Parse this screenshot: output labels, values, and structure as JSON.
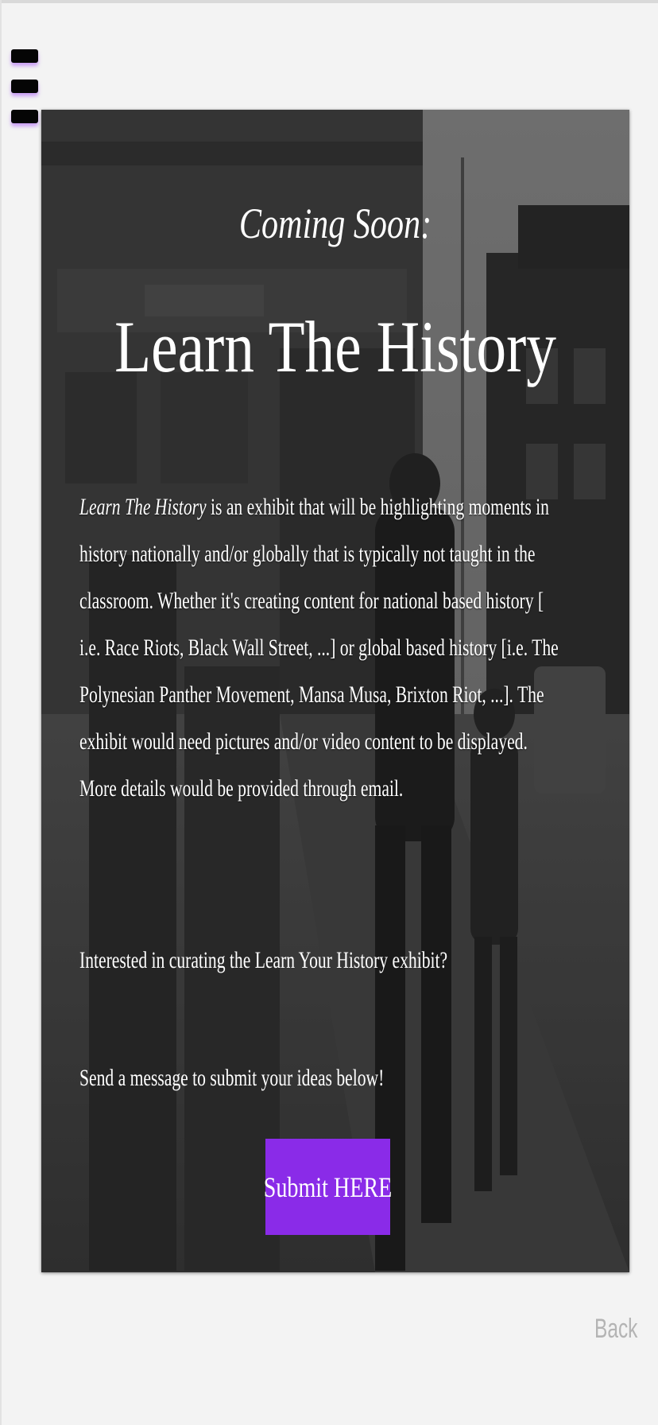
{
  "nav": {
    "menu_icon": "hamburger-menu-icon",
    "menu_glow_color": "#aa5af5"
  },
  "hero": {
    "background": "black-and-white street photo with The Atlantic building",
    "coming_soon": "Coming Soon:",
    "title": "Learn The History",
    "paragraph": {
      "em": "Learn The History",
      "rest": " is an exhibit that will be highlighting moments in history nationally and/or globally that is typically not taught in the classroom. Whether it's creating content for national based history [ i.e.  Race Riots, Black Wall Street, ...] or global based history [i.e. The Polynesian Panther Movement, Mansa Musa, Brixton Riot, ...]. The exhibit would need pictures and/or video content to be displayed. More details would be provided through email."
    },
    "question": "Interested in curating the Learn Your History exhibit?",
    "call_to_action": "Send a message to submit your ideas below!",
    "submit_label": "Submit HERE",
    "accent_color": "#8a2be8"
  },
  "footer": {
    "back_label": "Back"
  }
}
